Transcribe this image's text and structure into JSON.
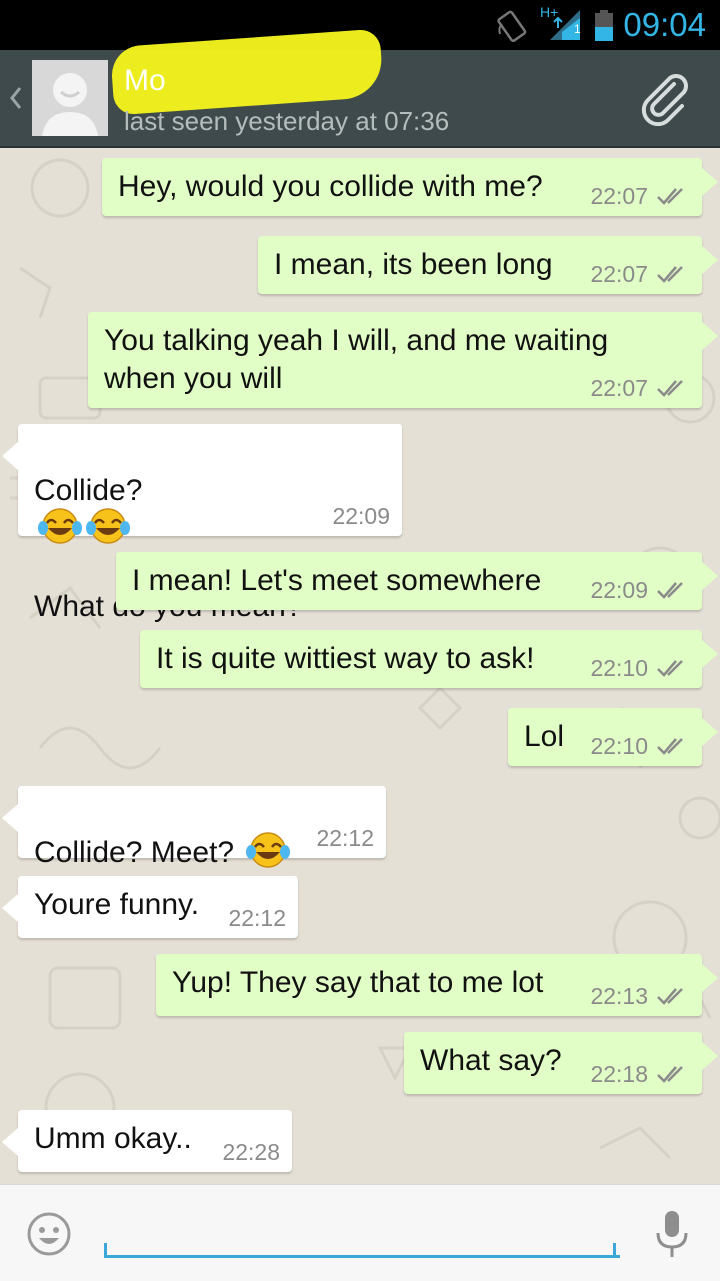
{
  "status_bar": {
    "time": "09:04",
    "network_label": "H+",
    "sim_label": "1"
  },
  "header": {
    "contact_name": "Mo",
    "last_seen": "last seen yesterday at 07:36",
    "icons": [
      "back-chevron-icon",
      "avatar-placeholder",
      "paperclip-icon"
    ]
  },
  "messages": [
    {
      "dir": "out",
      "text": "Hey, would you collide with me?",
      "time": "22:07",
      "ticks": "double"
    },
    {
      "dir": "out",
      "text": "I mean, its been long",
      "time": "22:07",
      "ticks": "double"
    },
    {
      "dir": "out",
      "text": "You talking yeah I will, and me waiting\nwhen you will",
      "time": "22:07",
      "ticks": "double"
    },
    {
      "dir": "in",
      "text": "Collide? \nWhat do you mean?",
      "time": "22:09",
      "emoji": "tears-of-joy x2"
    },
    {
      "dir": "out",
      "text": "I mean! Let's meet somewhere",
      "time": "22:09",
      "ticks": "double"
    },
    {
      "dir": "out",
      "text": "It is quite wittiest way to ask!",
      "time": "22:10",
      "ticks": "double"
    },
    {
      "dir": "out",
      "text": "Lol",
      "time": "22:10",
      "ticks": "double"
    },
    {
      "dir": "in",
      "text": "Collide? Meet? ",
      "time": "22:12",
      "emoji": "tears-of-joy"
    },
    {
      "dir": "in",
      "text": "Youre funny.",
      "time": "22:12"
    },
    {
      "dir": "out",
      "text": "Yup! They say that to me lot",
      "time": "22:13",
      "ticks": "double"
    },
    {
      "dir": "out",
      "text": "What say?",
      "time": "22:18",
      "ticks": "double"
    },
    {
      "dir": "in",
      "text": "Umm okay..",
      "time": "22:28"
    }
  ],
  "input_bar": {
    "message_value": "",
    "icons": [
      "smiley-icon",
      "microphone-icon"
    ]
  },
  "colors": {
    "header_bg": "#3e4a4b",
    "outgoing_bubble": "#e1fec6",
    "incoming_bubble": "#ffffff",
    "status_accent": "#33b5e5",
    "input_underline": "#3aa7d8"
  }
}
